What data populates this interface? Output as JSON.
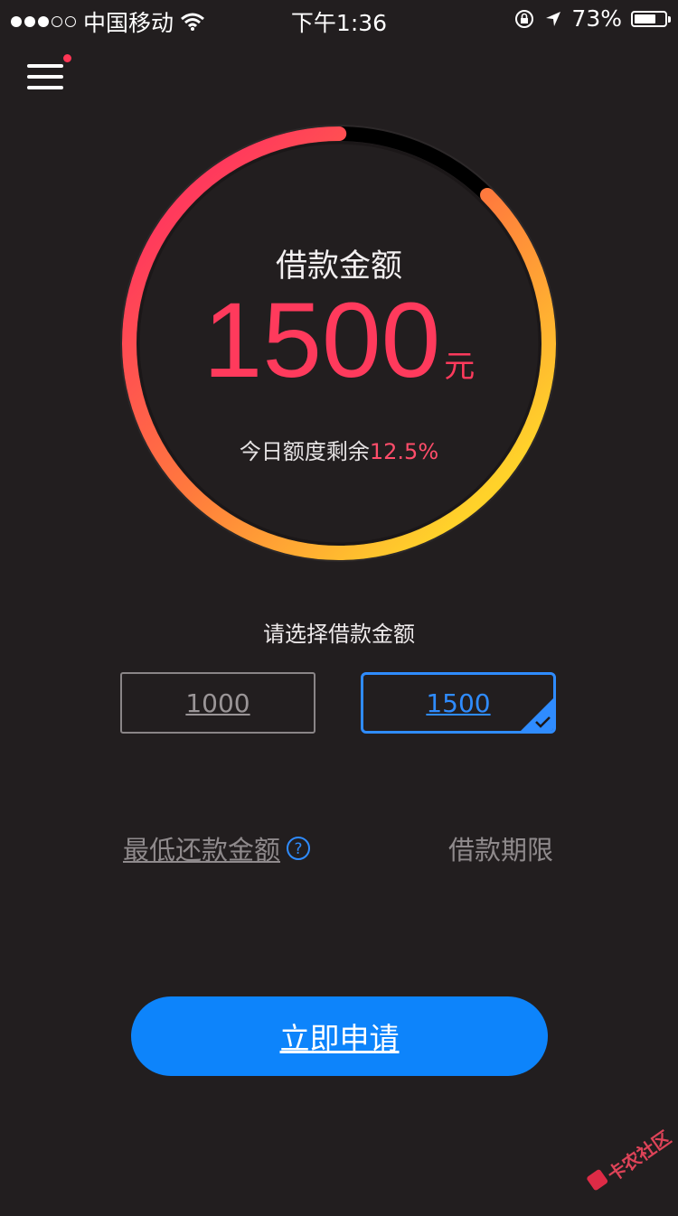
{
  "status_bar": {
    "carrier": "中国移动",
    "time": "下午1:36",
    "battery_percent": "73%",
    "battery_level": 0.73,
    "signal_bars_filled": 3,
    "signal_bars_total": 5,
    "icons": [
      "wifi-icon",
      "rotation-lock-icon",
      "location-arrow-icon",
      "battery-icon"
    ]
  },
  "header": {
    "menu_icon": "hamburger-menu-icon",
    "menu_badge_color": "#ff3655"
  },
  "gauge": {
    "title": "借款金额",
    "amount": "1500",
    "unit": "元",
    "remaining_label": "今日额度剩余",
    "remaining_value": "12.5%",
    "remaining_fraction": 0.125,
    "colors": {
      "start": "#ff3a5c",
      "mid": "#ff7a3d",
      "end": "#ffd22a",
      "track": "#000000"
    }
  },
  "selector": {
    "label": "请选择借款金额",
    "options": [
      {
        "label": "1000",
        "selected": false
      },
      {
        "label": "1500",
        "selected": true
      }
    ],
    "selected_color": "#2f8cff"
  },
  "details": {
    "min_repayment_label": "最低还款金额",
    "help_icon": "question-circle-icon",
    "term_label": "借款期限"
  },
  "actions": {
    "apply_label": "立即申请",
    "apply_color": "#0d84fb"
  },
  "watermark": {
    "text": "卡农社区"
  }
}
